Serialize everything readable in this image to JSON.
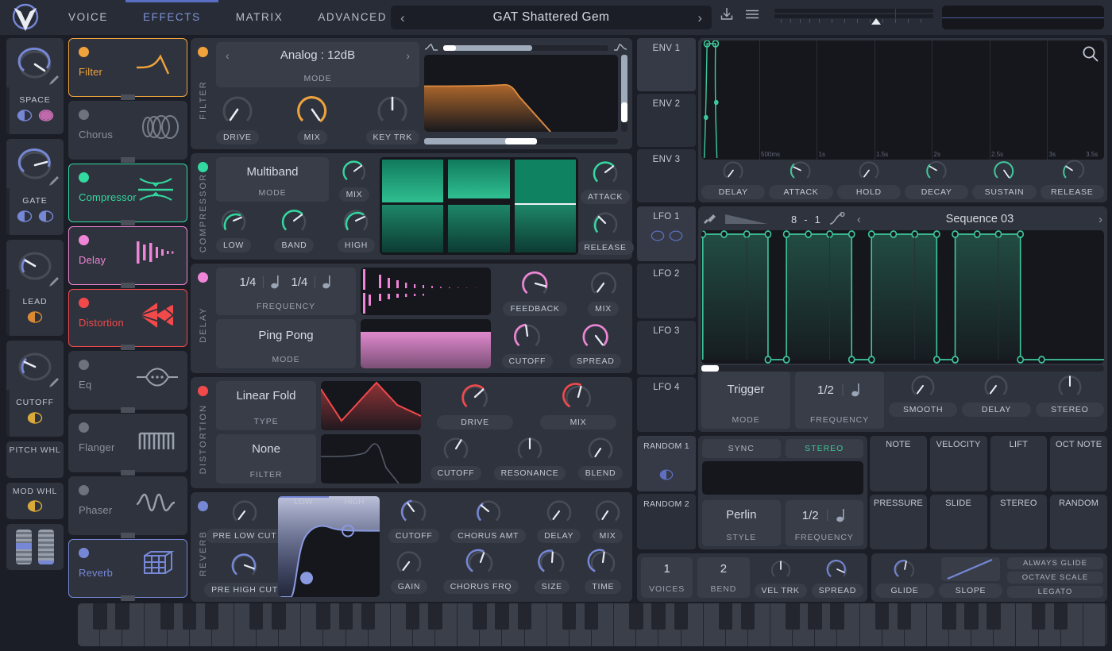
{
  "header": {
    "logo_icon": "vital-logo-icon",
    "tabs": [
      {
        "label": "VOICE",
        "active": false
      },
      {
        "label": "EFFECTS",
        "active": true
      },
      {
        "label": "MATRIX",
        "active": false
      },
      {
        "label": "ADVANCED",
        "active": false
      }
    ],
    "preset_name": "GAT Shattered Gem",
    "prev_icon": "chevron-left-icon",
    "next_icon": "chevron-right-icon",
    "download_icon": "download-icon",
    "menu_icon": "hamburger-menu-icon",
    "oscilloscope_icon": "oscilloscope-display"
  },
  "macros": [
    {
      "name": "SPACE",
      "value": 0.72,
      "color": "#7687d6",
      "dots": [
        "#7687d6",
        "#d06fb8"
      ],
      "pencil_icon": "pencil-icon"
    },
    {
      "name": "GATE",
      "value": 0.78,
      "color": "#7687d6",
      "dots": [
        "#7687d6",
        "#7687d6"
      ],
      "pencil_icon": "pencil-icon"
    },
    {
      "name": "LEAD",
      "value": 0.18,
      "color": "#7687d6",
      "dots": [
        "#d98a33"
      ],
      "pencil_icon": "pencil-icon"
    },
    {
      "name": "CUTOFF",
      "value": 0.22,
      "color": "#7687d6",
      "dots": [
        "#d9a93a"
      ],
      "pencil_icon": "pencil-icon"
    }
  ],
  "wheels": [
    {
      "name": "PITCH WHL",
      "dot": null
    },
    {
      "name": "MOD WHL",
      "dot": "#d9a93a"
    }
  ],
  "effects_list": [
    {
      "label": "Filter",
      "enabled": true,
      "color": "#f0a33c",
      "icon": "filter-curve-icon"
    },
    {
      "label": "Chorus",
      "enabled": false,
      "color": "#6d727d",
      "icon": "chorus-rings-icon"
    },
    {
      "label": "Compressor",
      "enabled": true,
      "color": "#33d9a0",
      "icon": "compressor-icon"
    },
    {
      "label": "Delay",
      "enabled": true,
      "color": "#ef85d6",
      "icon": "delay-bars-icon"
    },
    {
      "label": "Distortion",
      "enabled": true,
      "color": "#f2494b",
      "icon": "distortion-burst-icon"
    },
    {
      "label": "Eq",
      "enabled": false,
      "color": "#6d727d",
      "icon": "eq-lens-icon"
    },
    {
      "label": "Flanger",
      "enabled": false,
      "color": "#6d727d",
      "icon": "flanger-comb-icon"
    },
    {
      "label": "Phaser",
      "enabled": false,
      "color": "#6d727d",
      "icon": "phaser-wave-icon"
    },
    {
      "label": "Reverb",
      "enabled": true,
      "color": "#7687d6",
      "icon": "reverb-cube-icon"
    }
  ],
  "modules": {
    "filter": {
      "title": "FILTER",
      "color": "#f0a33c",
      "mode_value": "Analog : 12dB",
      "mode_label": "MODE",
      "prev_icon": "chevron-left-icon",
      "next_icon": "chevron-right-icon",
      "knobs": [
        {
          "label": "DRIVE",
          "value": 0.12,
          "accent": false
        },
        {
          "label": "MIX",
          "value": 0.86,
          "accent": true
        },
        {
          "label": "KEY TRK",
          "value": 0.5,
          "accent": false
        }
      ],
      "viz": "filter-response-curve",
      "top_slider": 0.24,
      "bottom_slider": 0.46,
      "right_slider": 0.62,
      "left_wave_icon": "lowpass-icon",
      "right_wave_icon": "highpass-icon"
    },
    "compressor": {
      "title": "COMPRESSOR",
      "color": "#33d9a0",
      "mode_value": "Multiband",
      "mode_label": "MODE",
      "knobs": [
        {
          "label": "MIX",
          "value": 0.82
        },
        {
          "label": "LOW",
          "value": 0.74
        },
        {
          "label": "BAND",
          "value": 0.8
        },
        {
          "label": "HIGH",
          "value": 0.78
        },
        {
          "label": "ATTACK",
          "value": 0.84
        },
        {
          "label": "RELEASE",
          "value": 0.18
        }
      ],
      "viz": "multiband-meters",
      "bands": [
        {
          "upper": 0.92,
          "lower": 0.78
        },
        {
          "upper": 0.8,
          "lower": 0.74
        },
        {
          "upper": 1.0,
          "lower": 0.7
        }
      ]
    },
    "delay": {
      "title": "DELAY",
      "color": "#ef85d6",
      "freq_left": "1/4",
      "freq_right": "1/4",
      "frequency_label": "FREQUENCY",
      "note_icon": "quarter-note-icon",
      "mode_value": "Ping Pong",
      "mode_label": "MODE",
      "knobs": [
        {
          "label": "FEEDBACK",
          "value": 0.8
        },
        {
          "label": "MIX",
          "value": 0.18
        },
        {
          "label": "CUTOFF",
          "value": 0.5
        },
        {
          "label": "SPREAD",
          "value": 0.88
        }
      ],
      "viz_top": "delay-taps-display",
      "viz_bottom": "delay-filter-display"
    },
    "distortion": {
      "title": "DISTORTION",
      "color": "#f2494b",
      "type_value": "Linear Fold",
      "type_label": "TYPE",
      "filter_value": "None",
      "filter_label": "FILTER",
      "knobs": [
        {
          "label": "DRIVE",
          "value": 0.8,
          "accent": true
        },
        {
          "label": "MIX",
          "value": 0.96,
          "accent": true
        },
        {
          "label": "CUTOFF",
          "value": 0.62
        },
        {
          "label": "RESONANCE",
          "value": 0.5
        },
        {
          "label": "BLEND",
          "value": 0.15
        }
      ],
      "viz_top": "waveshaper-curve",
      "viz_bottom": "distortion-filter-curve"
    },
    "reverb": {
      "title": "REVERB",
      "color": "#7687d6",
      "tabs": [
        "LOW",
        "HIGH"
      ],
      "active_tab": "LOW",
      "knobs": [
        {
          "label": "PRE LOW CUT",
          "value": 0.14
        },
        {
          "label": "PRE HIGH CUT",
          "value": 0.78
        },
        {
          "label": "CUTOFF",
          "value": 0.88
        },
        {
          "label": "CHORUS AMT",
          "value": 0.8
        },
        {
          "label": "DELAY",
          "value": 0.14
        },
        {
          "label": "MIX",
          "value": 0.16
        },
        {
          "label": "GAIN",
          "value": 0.12
        },
        {
          "label": "CHORUS FRQ",
          "value": 0.7
        },
        {
          "label": "SIZE",
          "value": 0.55
        },
        {
          "label": "TIME",
          "value": 0.56
        }
      ],
      "viz": "reverb-eq-curve"
    }
  },
  "envelope": {
    "tabs": [
      {
        "label": "ENV 1",
        "active": true
      },
      {
        "label": "ENV 2",
        "active": false
      },
      {
        "label": "ENV 3",
        "active": false
      }
    ],
    "search_icon": "search-icon",
    "time_ticks": [
      "500ms",
      "1s",
      "1.5s",
      "2s",
      "2.5s",
      "3s",
      "3.5s"
    ],
    "knobs": [
      {
        "label": "DELAY",
        "value": 0.12
      },
      {
        "label": "ATTACK",
        "value": 0.32
      },
      {
        "label": "HOLD",
        "value": 0.12
      },
      {
        "label": "DECAY",
        "value": 0.3
      },
      {
        "label": "SUSTAIN",
        "value": 0.92
      },
      {
        "label": "RELEASE",
        "value": 0.28
      }
    ],
    "curve": "env-adsr-curve"
  },
  "lfo": {
    "tabs": [
      {
        "label": "LFO 1",
        "active": true
      },
      {
        "label": "LFO 2",
        "active": false
      },
      {
        "label": "LFO 3",
        "active": false
      },
      {
        "label": "LFO 4",
        "active": false
      }
    ],
    "paint_icon": "paint-brush-icon",
    "ramp_icon": "ramp-shape-icon",
    "grid_numerator": "8",
    "grid_separator": "-",
    "grid_denominator": "1",
    "curve_icon": "curve-tool-icon",
    "prev_icon": "chevron-left-icon",
    "next_icon": "chevron-right-icon",
    "sequence_name": "Sequence 03",
    "steps": [
      1,
      1,
      1,
      1,
      0,
      1,
      1,
      1,
      1,
      0,
      1,
      1,
      1,
      1,
      0,
      1,
      1,
      1,
      1,
      0
    ],
    "controls": [
      {
        "value": "Trigger",
        "label": "MODE"
      },
      {
        "value": "1/2",
        "label": "FREQUENCY",
        "note_icon": "quarter-note-icon"
      }
    ],
    "knobs": [
      {
        "label": "SMOOTH",
        "value": 0.14
      },
      {
        "label": "DELAY",
        "value": 0.14
      },
      {
        "label": "STEREO",
        "value": 0.5
      }
    ]
  },
  "random": {
    "tabs": [
      {
        "label": "RANDOM 1",
        "active": true
      },
      {
        "label": "RANDOM 2",
        "active": false
      }
    ],
    "sync_label": "SYNC",
    "stereo_label": "STEREO",
    "stereo_on": true,
    "style_value": "Perlin",
    "style_label": "STYLE",
    "freq_value": "1/2",
    "freq_label": "FREQUENCY",
    "note_icon": "quarter-note-icon"
  },
  "mod_sources": [
    [
      "NOTE",
      "VELOCITY",
      "LIFT",
      "OCT NOTE"
    ],
    [
      "PRESSURE",
      "SLIDE",
      "STEREO",
      "RANDOM"
    ]
  ],
  "voice": {
    "cells": [
      {
        "value": "1",
        "label": "VOICES"
      },
      {
        "value": "2",
        "label": "BEND"
      }
    ],
    "knobs": [
      {
        "label": "VEL TRK",
        "value": 0.5
      },
      {
        "label": "SPREAD",
        "value": 0.86
      }
    ],
    "glide_knobs": [
      {
        "label": "GLIDE",
        "value": 0.8
      },
      {
        "label": "SLOPE",
        "value": 0.6
      }
    ],
    "toggles": [
      {
        "label": "ALWAYS GLIDE",
        "on": false
      },
      {
        "label": "OCTAVE SCALE",
        "on": false
      },
      {
        "label": "LEGATO",
        "on": false
      }
    ]
  },
  "colors": {
    "bg": "#1b1e26",
    "panel": "#2f333d",
    "cell": "#383d48",
    "viz_bg": "#15171d",
    "accent_blue": "#7687d6",
    "accent_orange": "#f0a33c",
    "accent_green": "#33d9a0",
    "accent_pink": "#ef85d6",
    "accent_red": "#f2494b",
    "text": "#c5cad4",
    "text_dim": "#8b909b"
  }
}
